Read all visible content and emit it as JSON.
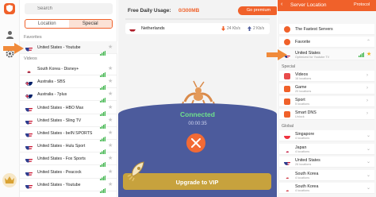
{
  "sidebar": {
    "icons": [
      "logo-shield-icon",
      "user-icon",
      "gear-icon",
      "crown-icon"
    ]
  },
  "list": {
    "search_placeholder": "Search",
    "tabs": [
      {
        "label": "Location",
        "active": false
      },
      {
        "label": "Special",
        "active": true
      }
    ],
    "favorites_label": "Favorites",
    "videos_label": "Videos",
    "favorites": [
      {
        "name": "United States - Youtube",
        "flag": "us"
      }
    ],
    "videos": [
      {
        "name": "South Korea - Disney+",
        "flag": "kr"
      },
      {
        "name": "Australia - SBS",
        "flag": "au"
      },
      {
        "name": "Australia - 7plus",
        "flag": "au"
      },
      {
        "name": "United States - HBO Max",
        "flag": "us"
      },
      {
        "name": "United States - Sling TV",
        "flag": "us"
      },
      {
        "name": "United States - beIN SPORTS",
        "flag": "us"
      },
      {
        "name": "United States - Hulu Sport",
        "flag": "us"
      },
      {
        "name": "United States - Fox Sports",
        "flag": "us"
      },
      {
        "name": "United States - Peacock",
        "flag": "us"
      },
      {
        "name": "United States - Youtube",
        "flag": "us"
      }
    ]
  },
  "main": {
    "usage_label": "Free Daily Usage:",
    "usage_value": "0/300MB",
    "usage_fraction": 0.0,
    "premium_label": "Go premium",
    "location": "Netherlands",
    "down_speed": "24 Kb/s",
    "up_speed": "2 Kb/s",
    "status": "Connected",
    "timer": "00:00:35",
    "upgrade_label": "Upgrade to VIP"
  },
  "right": {
    "back": "‹",
    "title": "Server Location",
    "protocol": "Protocol",
    "fastest": "The Fastest Servers",
    "favorite": "Favorite",
    "fav_item": {
      "name": "United States",
      "sub": "Optimized for Youtube TV"
    },
    "special_label": "Special",
    "special": [
      {
        "name": "Videos",
        "sub": "16 locations",
        "color": "#e84b4b"
      },
      {
        "name": "Game",
        "sub": "20 locations",
        "color": "#f0612a"
      },
      {
        "name": "Sport",
        "sub": "5 locations",
        "color": "#f0612a"
      },
      {
        "name": "Smart DNS",
        "sub": "Unlock",
        "color": "#f0612a"
      }
    ],
    "global_label": "Global",
    "global": [
      {
        "name": "Singapore",
        "sub": "4 locations",
        "flag": "sg"
      },
      {
        "name": "Japan",
        "sub": "4 locations",
        "flag": "jp"
      },
      {
        "name": "United States",
        "sub": "26 locations",
        "flag": "us"
      },
      {
        "name": "South Korea",
        "sub": "4 locations",
        "flag": "kr"
      },
      {
        "name": "South Korea",
        "sub": "4 locations",
        "flag": "kr"
      }
    ]
  },
  "colors": {
    "accent": "#f0612a",
    "panel_blue": "#4c5b9c",
    "connected_green": "#6fe08c",
    "vip_gold": "#c7a23d"
  }
}
